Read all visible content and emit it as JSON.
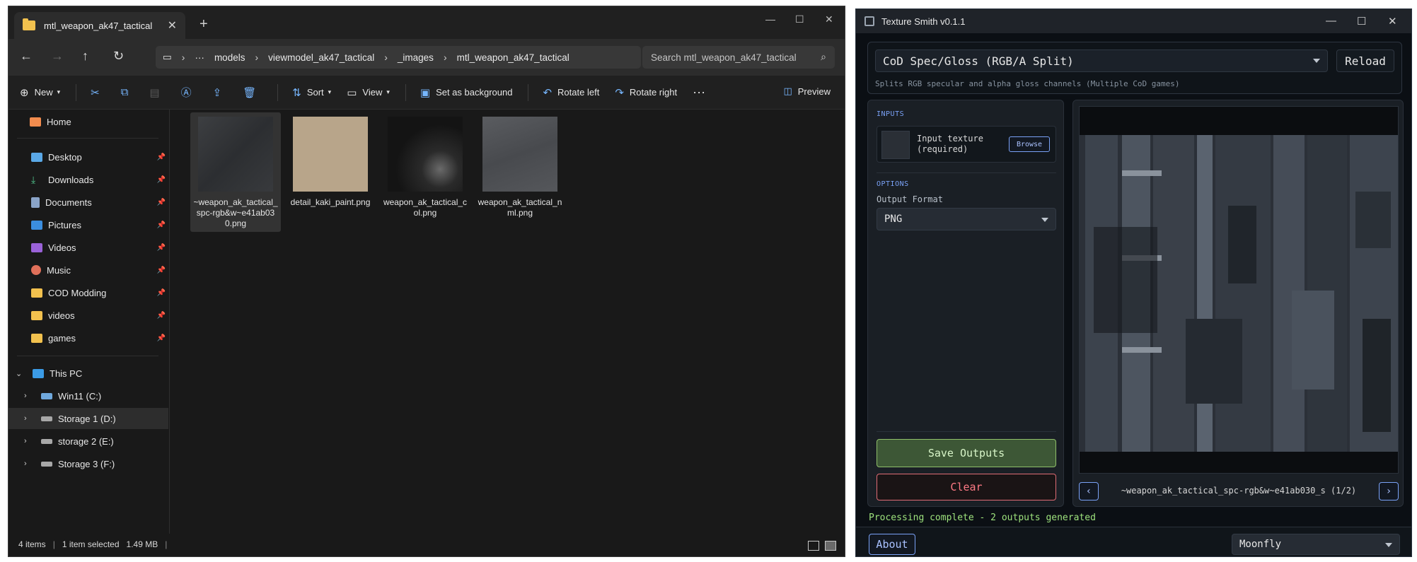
{
  "explorer": {
    "tab_title": "mtl_weapon_ak47_tactical",
    "breadcrumb": [
      "models",
      "viewmodel_ak47_tactical",
      "_images",
      "mtl_weapon_ak47_tactical"
    ],
    "breadcrumb_overflow": "···",
    "search_placeholder": "Search mtl_weapon_ak47_tactical",
    "toolbar": {
      "new": "New",
      "sort": "Sort",
      "view": "View",
      "set_background": "Set as background",
      "rotate_left": "Rotate left",
      "rotate_right": "Rotate right",
      "more": "···",
      "preview": "Preview"
    },
    "sidebar": {
      "home": "Home",
      "quick": [
        "Desktop",
        "Downloads",
        "Documents",
        "Pictures",
        "Videos",
        "Music",
        "COD Modding",
        "videos",
        "games"
      ],
      "this_pc": "This PC",
      "drives": [
        "Win11 (C:)",
        "Storage 1 (D:)",
        "storage 2 (E:)",
        "Storage 3 (F:)"
      ]
    },
    "files": [
      {
        "name": "~weapon_ak_tactical_spc-rgb&w~e41ab030.png",
        "line1": "~weapon_ak_tactical_",
        "line2": "spc-rgb&w~e41ab03",
        "line3": "0.png"
      },
      {
        "name": "detail_kaki_paint.png",
        "line1": "detail_kaki_paint.png",
        "line2": "",
        "line3": ""
      },
      {
        "name": "weapon_ak_tactical_col.png",
        "line1": "weapon_ak_tactical_c",
        "line2": "ol.png",
        "line3": ""
      },
      {
        "name": "weapon_ak_tactical_nml.png",
        "line1": "weapon_ak_tactical_n",
        "line2": "ml.png",
        "line3": ""
      }
    ],
    "status": {
      "items": "4 items",
      "selected": "1 item selected",
      "size": "1.49 MB"
    }
  },
  "texture_smith": {
    "title": "Texture Smith v0.1.1",
    "preset": "CoD Spec/Gloss (RGB/A Split)",
    "preset_desc": "Splits RGB specular and alpha gloss channels (Multiple CoD games)",
    "reload": "Reload",
    "inputs_label": "INPUTS",
    "input_label_line1": "Input texture",
    "input_label_line2": "(required)",
    "browse": "Browse",
    "options_label": "OPTIONS",
    "output_format_label": "Output Format",
    "output_format": "PNG",
    "save": "Save Outputs",
    "clear": "Clear",
    "prev": "‹",
    "next": "›",
    "preview_name": "~weapon_ak_tactical_spc-rgb&w~e41ab030_s (1/2)",
    "status": "Processing complete - 2 outputs generated",
    "about": "About",
    "theme": "Moonfly"
  }
}
